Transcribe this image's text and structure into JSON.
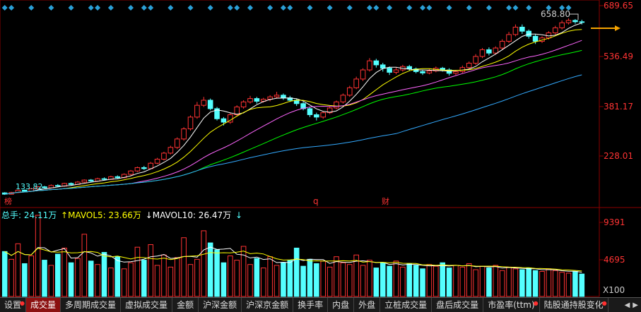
{
  "price_axis": {
    "labels": [
      "689.65",
      "536.49",
      "381.17",
      "228.01"
    ]
  },
  "volume_axis": {
    "labels": [
      "9391",
      "4695"
    ],
    "unit": "X100"
  },
  "annotations": {
    "high_label": "658.80",
    "low_label": "133.82",
    "markers": [
      "榜",
      "q",
      "财"
    ]
  },
  "volume_info": {
    "total_label": "总手: 24.11万",
    "mavol5_label": "↑MAVOL5: 23.66万",
    "mavol10_label": "↓MAVOL10: 26.47万",
    "arrow": "↓"
  },
  "tabs": [
    {
      "label": "设置",
      "active": false,
      "dot": true
    },
    {
      "label": "成交量",
      "active": true,
      "dot": false
    },
    {
      "label": "多周期成交量",
      "active": false,
      "dot": false
    },
    {
      "label": "虚拟成交量",
      "active": false,
      "dot": false
    },
    {
      "label": "金额",
      "active": false,
      "dot": false
    },
    {
      "label": "沪深金额",
      "active": false,
      "dot": false
    },
    {
      "label": "沪深京金额",
      "active": false,
      "dot": false
    },
    {
      "label": "换手率",
      "active": false,
      "dot": false
    },
    {
      "label": "内盘",
      "active": false,
      "dot": false
    },
    {
      "label": "外盘",
      "active": false,
      "dot": false
    },
    {
      "label": "立桩成交量",
      "active": false,
      "dot": false
    },
    {
      "label": "盘后成交量",
      "active": false,
      "dot": false
    },
    {
      "label": "市盈率(ttm)",
      "active": false,
      "dot": true
    },
    {
      "label": "陆股通持股变化",
      "active": false,
      "dot": true
    }
  ],
  "colors": {
    "up": "#ff3333",
    "down": "#54ffff",
    "ma5": "#ffffff",
    "ma10": "#ffff00",
    "ma20": "#ff66ff",
    "ma30": "#00ff00",
    "ma60": "#33aaff",
    "grid": "#8b0000"
  },
  "chart_data": {
    "type": "candlestick",
    "price_range": [
      130,
      700
    ],
    "candles": [
      [
        140,
        136,
        142,
        134
      ],
      [
        136,
        141,
        143,
        135
      ],
      [
        141,
        148,
        150,
        139
      ],
      [
        148,
        145,
        150,
        142
      ],
      [
        145,
        152,
        154,
        144
      ],
      [
        152,
        158,
        160,
        150
      ],
      [
        158,
        155,
        161,
        153
      ],
      [
        155,
        162,
        165,
        154
      ],
      [
        162,
        160,
        166,
        157
      ],
      [
        160,
        168,
        170,
        158
      ],
      [
        168,
        165,
        171,
        162
      ],
      [
        165,
        172,
        175,
        164
      ],
      [
        172,
        178,
        180,
        170
      ],
      [
        178,
        175,
        181,
        172
      ],
      [
        175,
        182,
        185,
        173
      ],
      [
        182,
        180,
        186,
        177
      ],
      [
        180,
        188,
        191,
        178
      ],
      [
        188,
        185,
        192,
        182
      ],
      [
        185,
        195,
        198,
        183
      ],
      [
        195,
        205,
        208,
        192
      ],
      [
        205,
        215,
        218,
        202
      ],
      [
        215,
        212,
        220,
        208
      ],
      [
        212,
        228,
        232,
        210
      ],
      [
        228,
        240,
        244,
        225
      ],
      [
        240,
        258,
        262,
        236
      ],
      [
        258,
        275,
        280,
        254
      ],
      [
        275,
        300,
        305,
        270
      ],
      [
        300,
        330,
        335,
        295
      ],
      [
        330,
        365,
        370,
        325
      ],
      [
        365,
        400,
        410,
        360
      ],
      [
        400,
        415,
        425,
        395
      ],
      [
        415,
        390,
        420,
        385
      ],
      [
        390,
        360,
        395,
        355
      ],
      [
        360,
        350,
        365,
        340
      ],
      [
        350,
        372,
        378,
        345
      ],
      [
        372,
        395,
        400,
        368
      ],
      [
        395,
        410,
        415,
        390
      ],
      [
        410,
        420,
        428,
        405
      ],
      [
        420,
        412,
        425,
        405
      ],
      [
        412,
        418,
        422,
        408
      ],
      [
        418,
        425,
        430,
        412
      ],
      [
        425,
        430,
        440,
        420
      ],
      [
        430,
        422,
        435,
        416
      ],
      [
        422,
        415,
        428,
        410
      ],
      [
        415,
        405,
        420,
        398
      ],
      [
        405,
        390,
        410,
        385
      ],
      [
        390,
        372,
        395,
        365
      ],
      [
        372,
        365,
        378,
        355
      ],
      [
        365,
        378,
        382,
        360
      ],
      [
        378,
        392,
        396,
        374
      ],
      [
        392,
        410,
        414,
        388
      ],
      [
        410,
        430,
        435,
        405
      ],
      [
        430,
        452,
        458,
        425
      ],
      [
        452,
        478,
        485,
        448
      ],
      [
        478,
        505,
        510,
        472
      ],
      [
        505,
        532,
        540,
        500
      ],
      [
        532,
        520,
        538,
        512
      ],
      [
        520,
        510,
        526,
        500
      ],
      [
        510,
        498,
        515,
        490
      ],
      [
        498,
        505,
        512,
        492
      ],
      [
        505,
        515,
        520,
        500
      ],
      [
        515,
        508,
        520,
        502
      ],
      [
        508,
        500,
        512,
        495
      ],
      [
        500,
        496,
        505,
        490
      ],
      [
        496,
        502,
        508,
        492
      ],
      [
        502,
        510,
        515,
        498
      ],
      [
        510,
        505,
        514,
        500
      ],
      [
        505,
        495,
        510,
        488
      ],
      [
        495,
        500,
        505,
        490
      ],
      [
        500,
        512,
        518,
        496
      ],
      [
        512,
        525,
        530,
        508
      ],
      [
        525,
        545,
        552,
        520
      ],
      [
        545,
        565,
        570,
        540
      ],
      [
        565,
        555,
        572,
        548
      ],
      [
        555,
        570,
        575,
        550
      ],
      [
        570,
        590,
        596,
        565
      ],
      [
        590,
        610,
        618,
        585
      ],
      [
        610,
        632,
        640,
        605
      ],
      [
        632,
        620,
        640,
        612
      ],
      [
        620,
        605,
        625,
        598
      ],
      [
        605,
        590,
        612,
        582
      ],
      [
        590,
        600,
        605,
        585
      ],
      [
        600,
        615,
        620,
        595
      ],
      [
        615,
        630,
        636,
        610
      ],
      [
        630,
        645,
        652,
        625
      ],
      [
        645,
        652,
        658,
        640
      ],
      [
        652,
        648,
        656,
        642
      ],
      [
        648,
        646,
        654,
        640
      ]
    ],
    "ma_series": [
      "MA5",
      "MA10",
      "MA20",
      "MA30",
      "MA60"
    ],
    "volumes": [
      5200,
      4300,
      6100,
      3800,
      4700,
      9391,
      4200,
      3600,
      4900,
      5600,
      3900,
      4400,
      7200,
      4100,
      3700,
      5100,
      3300,
      4600,
      3200,
      3900,
      5700,
      4200,
      6000,
      3600,
      4800,
      3400,
      4500,
      6800,
      3700,
      4300,
      7600,
      6200,
      5400,
      3900,
      4700,
      4200,
      5800,
      3700,
      4400,
      3300,
      4600,
      3600,
      3900,
      4200,
      5600,
      3500,
      4300,
      3800,
      4100,
      3400,
      4600,
      3900,
      3700,
      4800,
      3600,
      4200,
      3300,
      3900,
      3500,
      4100,
      3400,
      3800,
      3600,
      3200,
      3700,
      3500,
      3900,
      3300,
      3600,
      3400,
      3800,
      3100,
      3500,
      3300,
      3600,
      3000,
      3400,
      3200,
      3100,
      3300,
      3000,
      2900,
      3200,
      3000,
      2800,
      2700,
      2900,
      2600
    ],
    "volume_range": [
      0,
      9391
    ]
  }
}
